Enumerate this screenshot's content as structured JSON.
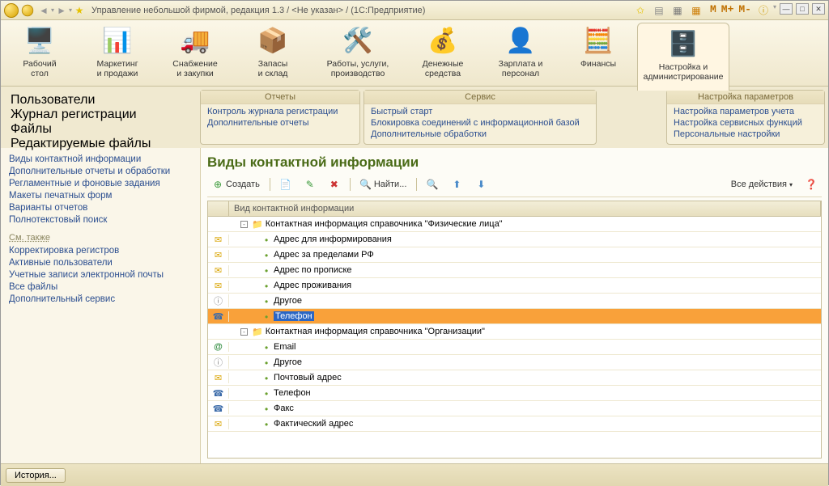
{
  "titlebar": {
    "title": "Управление небольшой фирмой, редакция 1.3 / <Не указан> / (1С:Предприятие)"
  },
  "sections": [
    {
      "label": "Рабочий\nстол"
    },
    {
      "label": "Маркетинг\nи продажи"
    },
    {
      "label": "Снабжение\nи закупки"
    },
    {
      "label": "Запасы\nи склад"
    },
    {
      "label": "Работы, услуги,\nпроизводство"
    },
    {
      "label": "Денежные\nсредства"
    },
    {
      "label": "Зарплата и\nперсонал"
    },
    {
      "label": "Финансы"
    },
    {
      "label": "Настройка и\nадминистрирование"
    }
  ],
  "sidebar_top": {
    "items": [
      "Пользователи",
      "Журнал регистрации",
      "Файлы",
      "Редактируемые файлы"
    ]
  },
  "panels": {
    "reports": {
      "title": "Отчеты",
      "items": [
        "Контроль журнала регистрации",
        "Дополнительные отчеты"
      ]
    },
    "service": {
      "title": "Сервис",
      "items": [
        "Быстрый старт",
        "Блокировка соединений с информационной базой",
        "Дополнительные обработки"
      ]
    },
    "settings": {
      "title": "Настройка параметров",
      "items": [
        "Настройка параметров учета",
        "Настройка сервисных функций",
        "Персональные настройки"
      ]
    }
  },
  "sidebar": {
    "group1": [
      "Виды контактной информации",
      "Дополнительные отчеты и обработки",
      "Регламентные и фоновые задания",
      "Макеты печатных форм",
      "Варианты отчетов",
      "Полнотекстовый поиск"
    ],
    "see_also_label": "См. также",
    "group2": [
      "Корректировка регистров",
      "Активные пользователи",
      "Учетные записи электронной почты",
      "Все файлы",
      "Дополнительный сервис"
    ]
  },
  "content": {
    "page_title": "Виды контактной информации",
    "create_label": "Создать",
    "find_label": "Найти...",
    "all_actions": "Все действия",
    "column_header": "Вид контактной информации",
    "rows": [
      {
        "icon": "",
        "type": "folder",
        "indent": 1,
        "toggle": "-",
        "label": "Контактная информация справочника \"Физические лица\""
      },
      {
        "icon": "mail",
        "type": "leaf",
        "indent": 2,
        "label": "Адрес для информирования"
      },
      {
        "icon": "mail",
        "type": "leaf",
        "indent": 2,
        "label": "Адрес за пределами РФ"
      },
      {
        "icon": "mail",
        "type": "leaf",
        "indent": 2,
        "label": "Адрес по прописке"
      },
      {
        "icon": "mail",
        "type": "leaf",
        "indent": 2,
        "label": "Адрес проживания"
      },
      {
        "icon": "dots",
        "type": "leaf",
        "indent": 2,
        "label": "Другое"
      },
      {
        "icon": "phone",
        "type": "leaf",
        "indent": 2,
        "label": "Телефон",
        "selected": true
      },
      {
        "icon": "",
        "type": "folder",
        "indent": 1,
        "toggle": "-",
        "label": "Контактная информация справочника \"Организации\""
      },
      {
        "icon": "at",
        "type": "leaf",
        "indent": 2,
        "label": "Email"
      },
      {
        "icon": "dots",
        "type": "leaf",
        "indent": 2,
        "label": "Другое"
      },
      {
        "icon": "mail",
        "type": "leaf",
        "indent": 2,
        "label": "Почтовый адрес"
      },
      {
        "icon": "phone",
        "type": "leaf",
        "indent": 2,
        "label": "Телефон"
      },
      {
        "icon": "phone",
        "type": "leaf",
        "indent": 2,
        "label": "Факс"
      },
      {
        "icon": "mail",
        "type": "leaf",
        "indent": 2,
        "label": "Фактический адрес"
      }
    ]
  },
  "bottombar": {
    "history": "История..."
  }
}
